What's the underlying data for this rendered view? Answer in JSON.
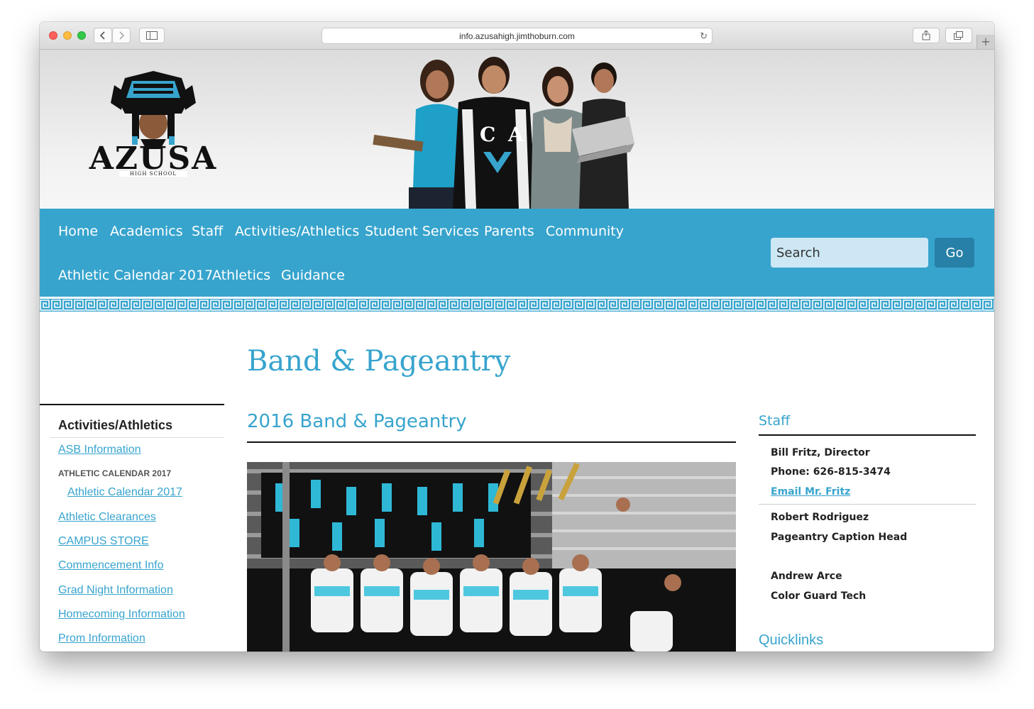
{
  "browser": {
    "url": "info.azusahigh.jimthoburn.com",
    "new_tab_symbol": "+"
  },
  "header": {
    "logo_text": "AZUSA",
    "logo_subtext": "HIGH SCHOOL"
  },
  "nav": {
    "items": [
      "Home",
      "Academics",
      "Staff",
      "Activities/Athletics",
      "Student Services",
      "Parents",
      "Community",
      "Athletic Calendar 2017",
      "Athletics",
      "Guidance"
    ],
    "search_placeholder": "Search",
    "go_label": "Go"
  },
  "main": {
    "page_title": "Band & Pageantry",
    "section_title": "2016 Band & Pageantry"
  },
  "sidebar": {
    "heading": "Activities/Athletics",
    "asb": "ASB Information",
    "calendar_label": "ATHLETIC CALENDAR 2017",
    "calendar_link": "Athletic Calendar 2017",
    "clearances": "Athletic Clearances",
    "store": "CAMPUS STORE",
    "commencement": "Commencement Info",
    "grad_night": "Grad Night Information",
    "homecoming": "Homecoming Information",
    "prom": "Prom Information"
  },
  "staff": {
    "heading": "Staff",
    "line1": "Bill Fritz, Director",
    "line2": "Phone:  626-815-3474",
    "email_link": "Email Mr. Fritz",
    "line3": "Robert Rodriguez",
    "line4": "Pageantry Caption Head",
    "line5": "Andrew Arce",
    "line6": "Color Guard Tech",
    "quicklinks": "Quicklinks"
  },
  "colors": {
    "accent": "#37a4cd",
    "accent_dark": "#2780a7",
    "search_bg": "#cde8f4"
  }
}
